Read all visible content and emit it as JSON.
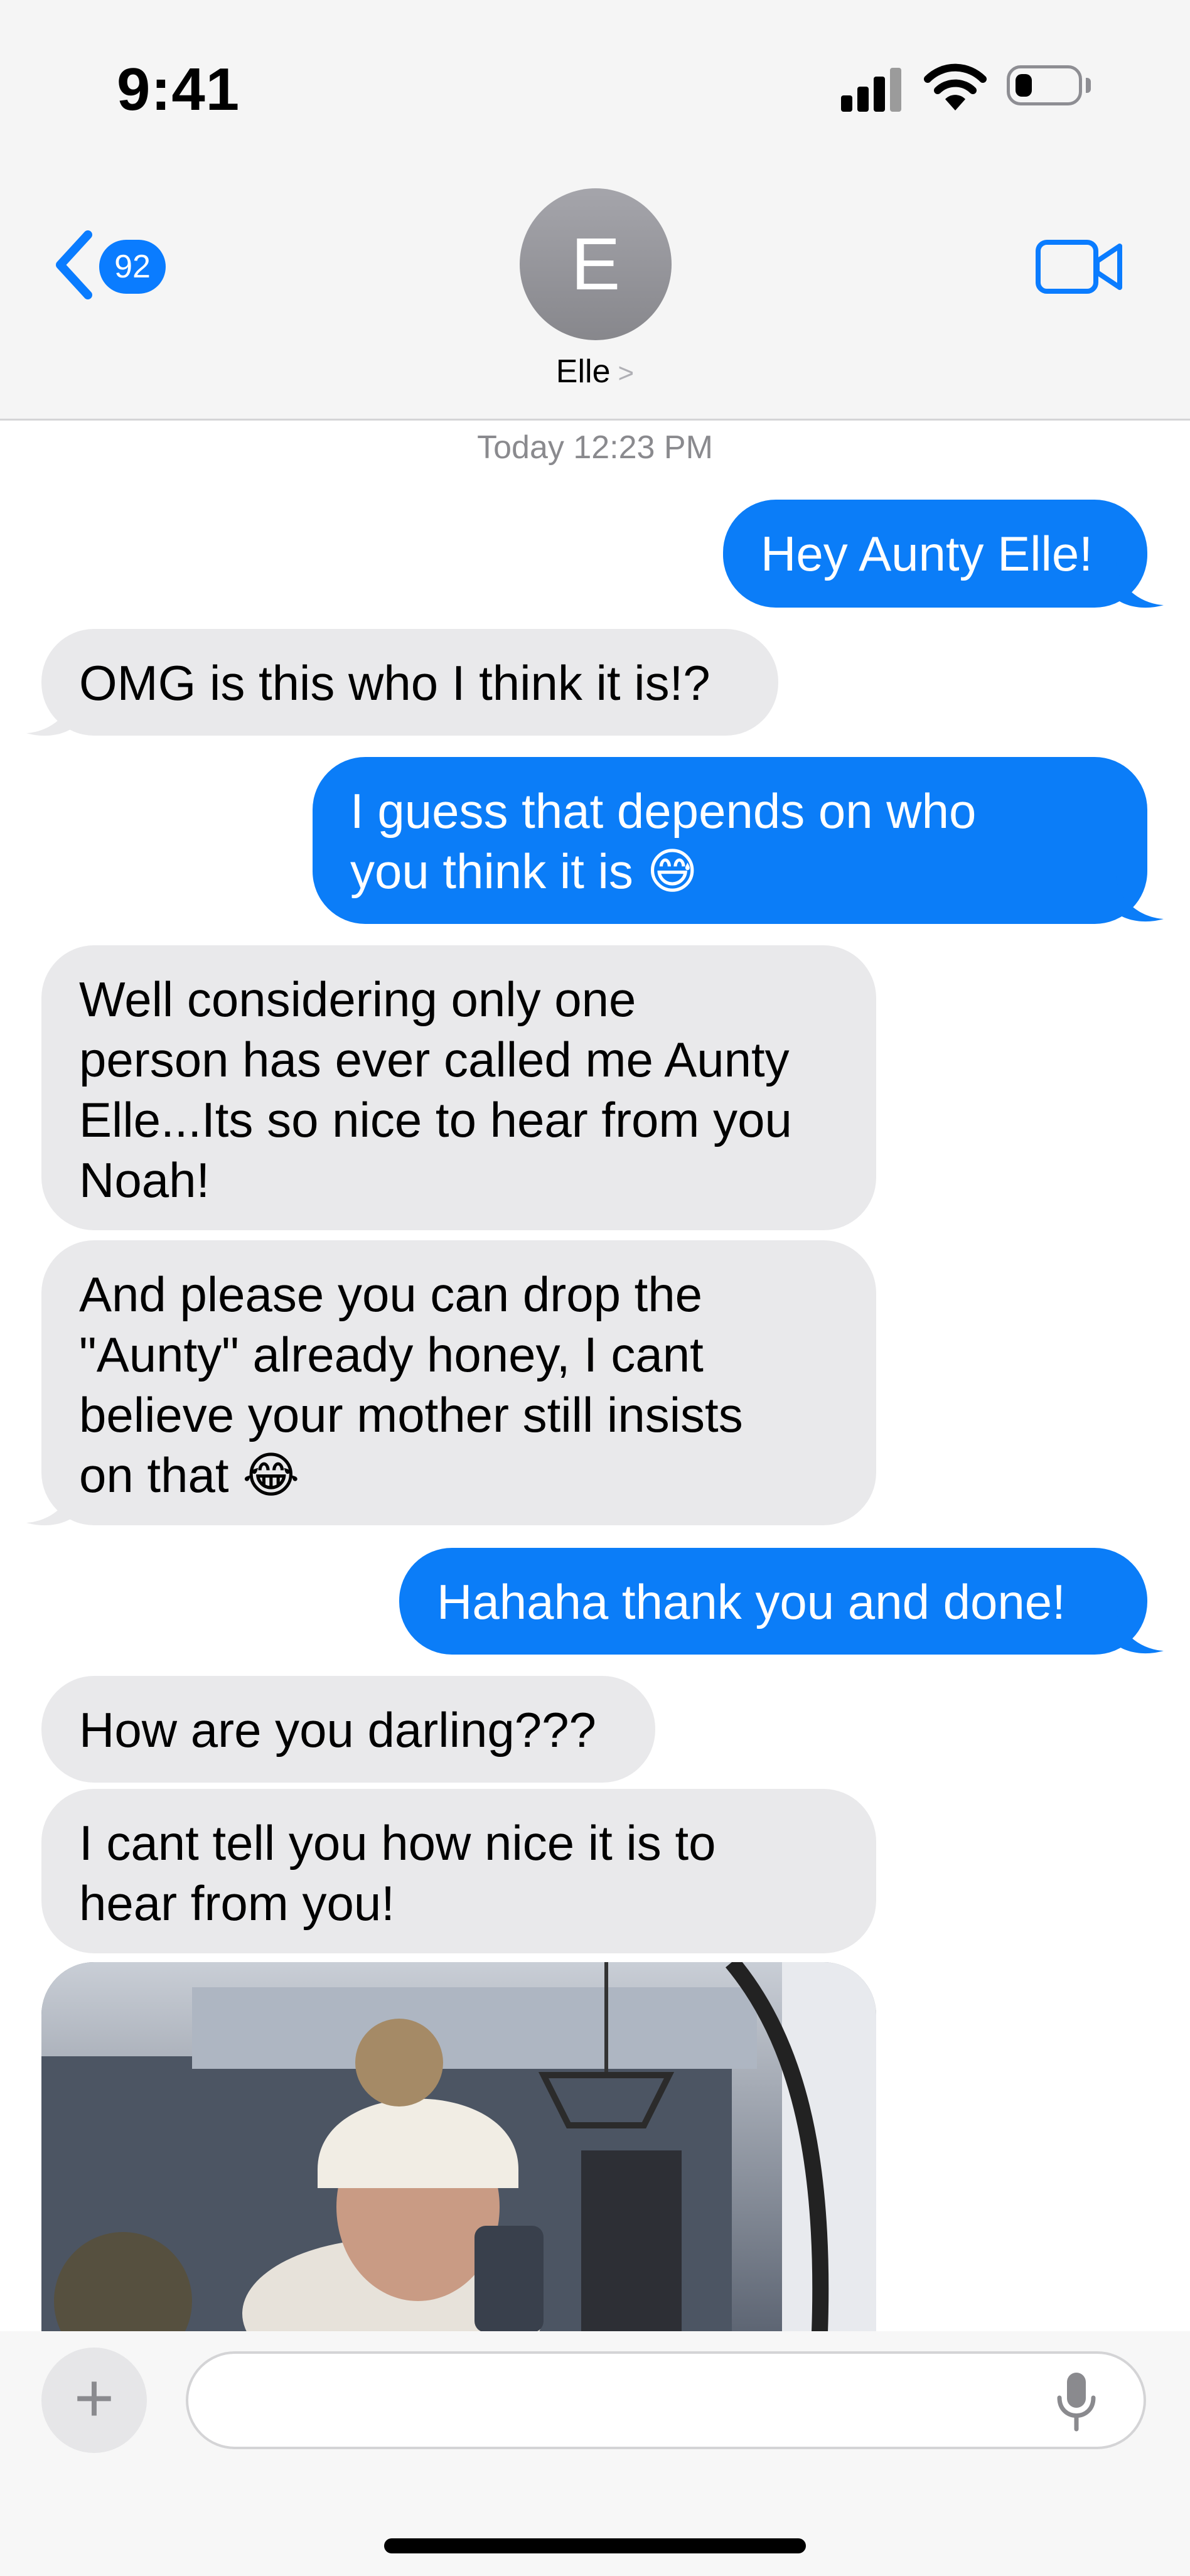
{
  "status": {
    "time": "9:41"
  },
  "nav": {
    "unread_count": "92",
    "contact_initial": "E",
    "contact_name": "Elle",
    "contact_chevron": ">"
  },
  "timestamp": "Today 12:23 PM",
  "messages": [
    {
      "from": "me",
      "text": "Hey Aunty Elle!"
    },
    {
      "from": "them",
      "text": "OMG is this who I think it is!?"
    },
    {
      "from": "me",
      "line1": "I guess that depends on who",
      "line2": "you think it is 😅"
    },
    {
      "from": "them",
      "line1": "Well considering only one",
      "line2": "person has ever called me Aunty",
      "line3": "Elle...Its so nice to hear from you",
      "line4": "Noah!"
    },
    {
      "from": "them",
      "line1": "And please you can drop the",
      "line2": "\"Aunty\" already honey, I cant",
      "line3": "believe your mother still insists",
      "line4": "on that 😂"
    },
    {
      "from": "me",
      "text": "Hahaha thank you and done!"
    },
    {
      "from": "them",
      "text": "How are you darling???"
    },
    {
      "from": "them",
      "line1": "I cant tell you how nice it is to",
      "line2": "hear from you!"
    }
  ],
  "composer": {
    "plus": "+",
    "placeholder": ""
  },
  "colors": {
    "sent_bubble": "#0b7df8",
    "received_bubble": "#e9e9eb",
    "accent": "#0a7cff"
  },
  "icons": [
    "back-chevron-icon",
    "video-camera-icon",
    "microphone-icon",
    "signal-icon",
    "wifi-icon",
    "battery-icon"
  ]
}
